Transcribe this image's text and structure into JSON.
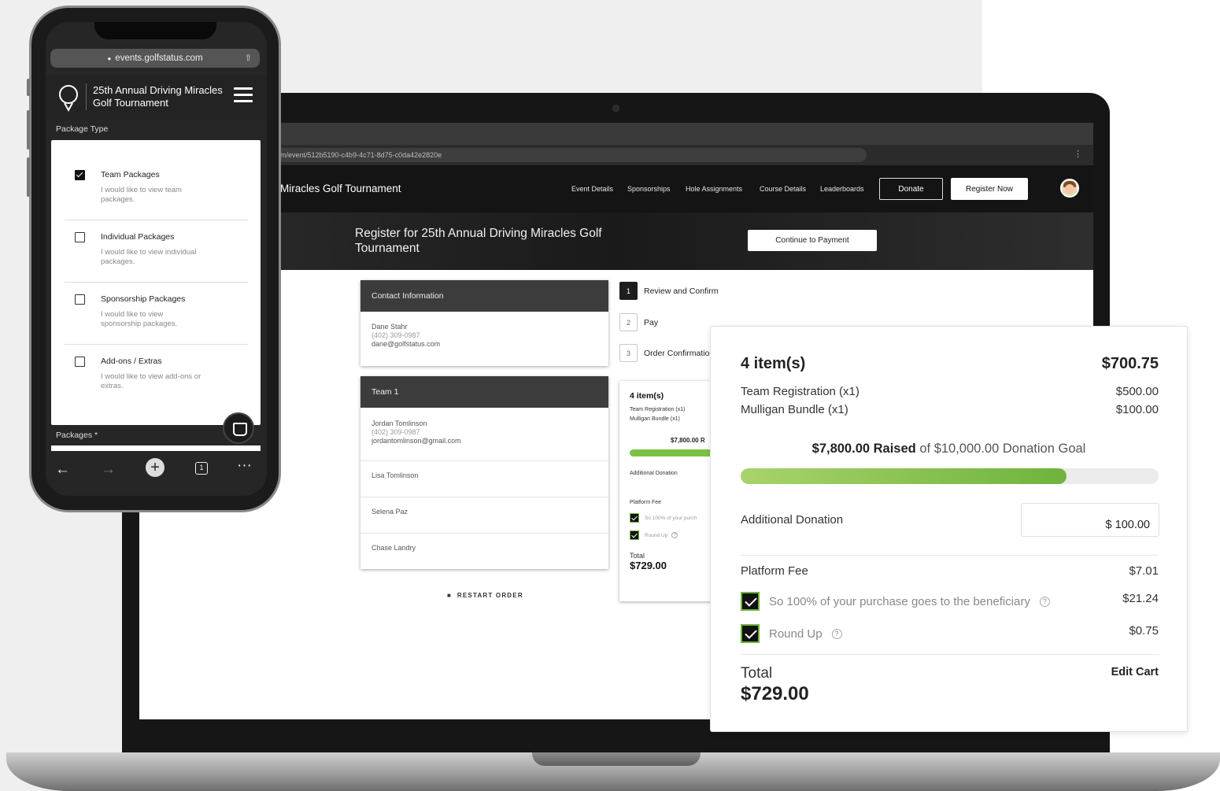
{
  "laptop": {
    "url": "m/event/512b5190-c4b9-4c71-8d75-c0da42e2820e",
    "site_title": "Miracles Golf Tournament",
    "nav": [
      "Event Details",
      "Sponsorships",
      "Hole Assignments",
      "Course Details",
      "Leaderboards"
    ],
    "donate_label": "Donate",
    "register_label": "Register Now",
    "hero_title": "Register for 25th Annual Driving Miracles Golf Tournament",
    "continue_label": "Continue to Payment",
    "contact": {
      "header": "Contact Information",
      "name": "Dane Stahr",
      "phone": "(402) 309-0987",
      "email": "dane@golfstatus.com"
    },
    "team": {
      "header": "Team 1",
      "captain_name": "Jordan Tomlinson",
      "captain_phone": "(402) 309-0987",
      "captain_email": "jordantomlinson@gmail.com",
      "members": [
        "Lisa Tomlinson",
        "Selena Paz",
        "Chase Landry"
      ]
    },
    "restart_label": "RESTART ORDER",
    "steps": [
      {
        "num": "1",
        "label": "Review and Confirm"
      },
      {
        "num": "2",
        "label": "Pay"
      },
      {
        "num": "3",
        "label": "Order Confirmatio"
      }
    ],
    "mini_summary": {
      "items": "4 item(s)",
      "line1": "Team Registration (x1)",
      "line2": "Mulligan Bundle (x1)",
      "raised": "$7,800.00 R",
      "addl": "Additional Donation",
      "platform": "Platform Fee",
      "cb1": "So 100% of your purch",
      "cb2": "Round Up",
      "total_label": "Total",
      "total_value": "$729.00"
    }
  },
  "summary": {
    "items_label": "4 item(s)",
    "items_total": "$700.75",
    "lines": [
      {
        "name": "Team Registration (x1)",
        "price": "$500.00"
      },
      {
        "name": "Mulligan Bundle (x1)",
        "price": "$100.00"
      }
    ],
    "raised_amount": "$7,800.00 Raised",
    "goal_text": "of $10,000.00 Donation Goal",
    "progress_fraction": 0.78,
    "additional_donation_label": "Additional Donation",
    "additional_donation_value": "$ 100.00",
    "platform_fee_label": "Platform Fee",
    "platform_fee_value": "$7.01",
    "beneficiary_label": "So 100% of your purchase goes to the beneficiary",
    "beneficiary_value": "$21.24",
    "roundup_label": "Round Up",
    "roundup_value": "$0.75",
    "total_label": "Total",
    "total_value": "$729.00",
    "edit_cart_label": "Edit Cart",
    "help_glyph": "?",
    "accent_color": "#7cc242"
  },
  "phone": {
    "url": "events.golfstatus.com",
    "event_title": "25th Annual Driving Miracles Golf Tournament",
    "package_type_label": "Package Type",
    "options": [
      {
        "title": "Team Packages",
        "desc": "I would like to view team packages.",
        "checked": true
      },
      {
        "title": "Individual Packages",
        "desc": "I would like to view individual packages.",
        "checked": false
      },
      {
        "title": "Sponsorship Packages",
        "desc": "I would like to view sponsorship packages.",
        "checked": false
      },
      {
        "title": "Add-ons / Extras",
        "desc": "I would like to view add-ons or extras.",
        "checked": false
      }
    ],
    "packages_label": "Packages *",
    "tab_count": "1"
  }
}
